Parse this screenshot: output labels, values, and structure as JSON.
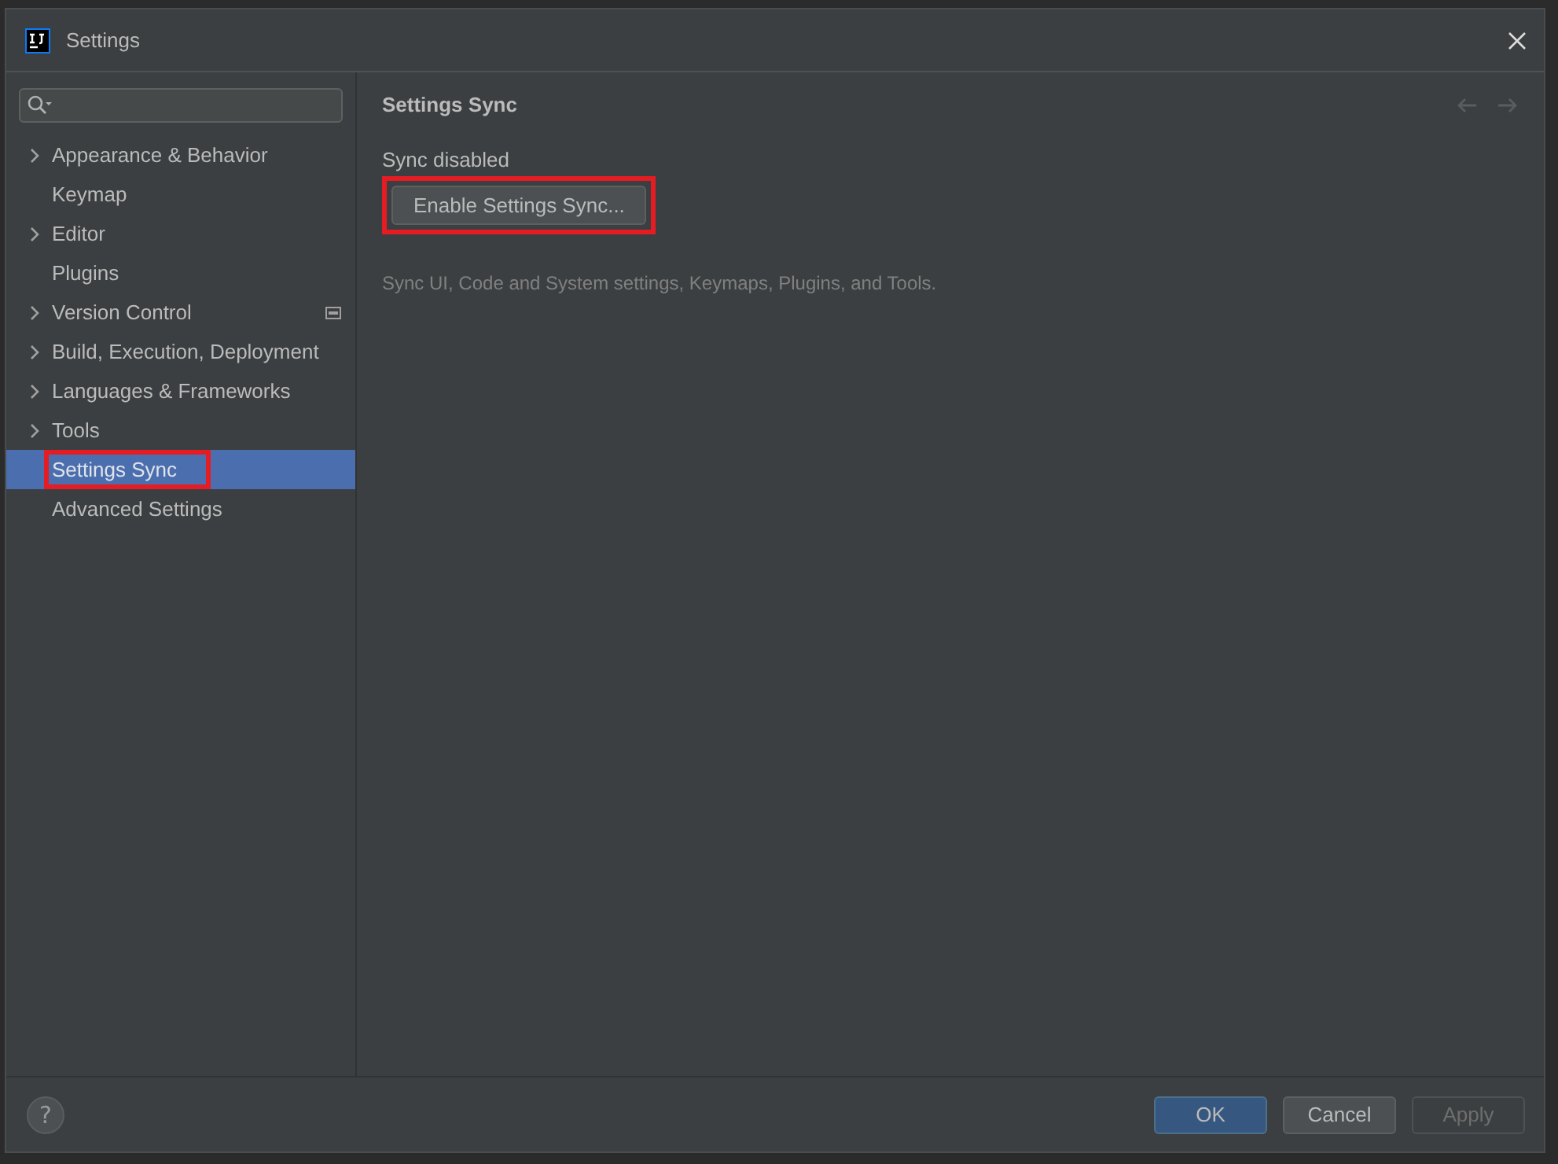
{
  "window": {
    "title": "Settings"
  },
  "sidebar": {
    "items": [
      {
        "label": "Appearance & Behavior",
        "kind": "group",
        "selected": false,
        "highlighted": false,
        "project_scope": false
      },
      {
        "label": "Keymap",
        "kind": "leaf",
        "selected": false,
        "highlighted": false,
        "project_scope": false
      },
      {
        "label": "Editor",
        "kind": "group",
        "selected": false,
        "highlighted": false,
        "project_scope": false
      },
      {
        "label": "Plugins",
        "kind": "leaf",
        "selected": false,
        "highlighted": false,
        "project_scope": false
      },
      {
        "label": "Version Control",
        "kind": "group",
        "selected": false,
        "highlighted": false,
        "project_scope": true
      },
      {
        "label": "Build, Execution, Deployment",
        "kind": "group",
        "selected": false,
        "highlighted": false,
        "project_scope": false
      },
      {
        "label": "Languages & Frameworks",
        "kind": "group",
        "selected": false,
        "highlighted": false,
        "project_scope": false
      },
      {
        "label": "Tools",
        "kind": "group",
        "selected": false,
        "highlighted": false,
        "project_scope": false
      },
      {
        "label": "Settings Sync",
        "kind": "leaf",
        "selected": true,
        "highlighted": true,
        "project_scope": false
      },
      {
        "label": "Advanced Settings",
        "kind": "leaf",
        "selected": false,
        "highlighted": false,
        "project_scope": false
      }
    ]
  },
  "content": {
    "title": "Settings Sync",
    "status": "Sync disabled",
    "button": {
      "label": "Enable Settings Sync...",
      "highlighted": true
    },
    "description": "Sync UI, Code and System settings, Keymaps, Plugins, and Tools."
  },
  "footer": {
    "help": "?",
    "buttons": [
      {
        "label": "OK",
        "kind": "primary",
        "disabled": false
      },
      {
        "label": "Cancel",
        "kind": "normal",
        "disabled": false
      },
      {
        "label": "Apply",
        "kind": "normal",
        "disabled": true
      }
    ]
  }
}
